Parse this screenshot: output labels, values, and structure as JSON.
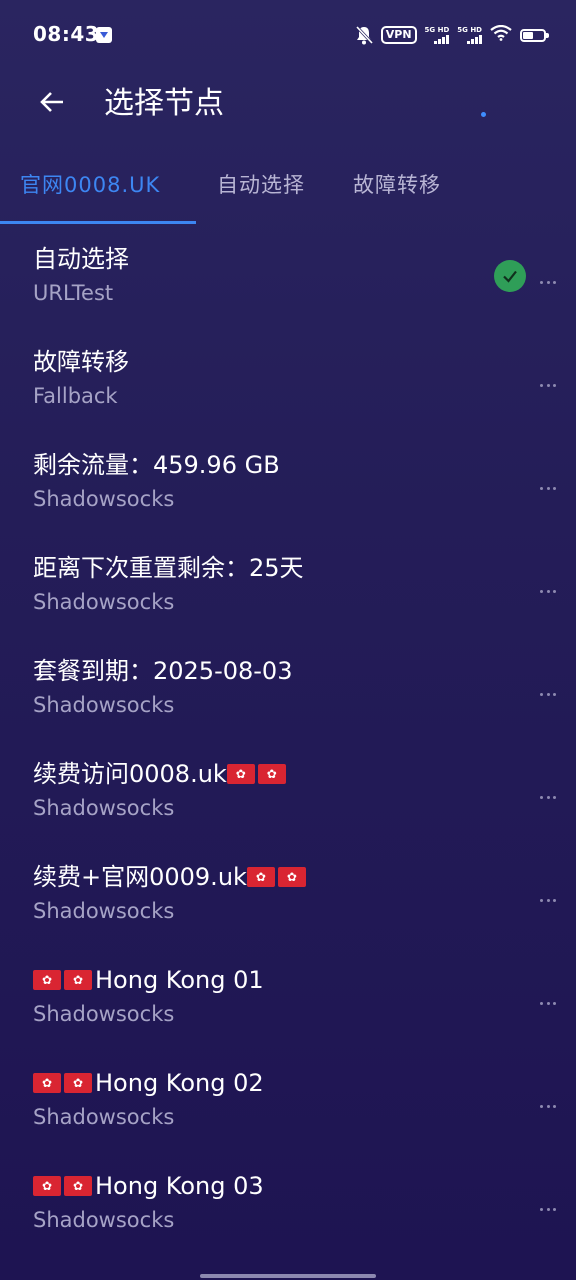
{
  "status_bar": {
    "time": "08:43",
    "vpn": "VPN",
    "sim1": "5G HD",
    "sim2": "5G HD"
  },
  "app_bar": {
    "title": "选择节点"
  },
  "tabs": [
    {
      "label": "官网0008.UK",
      "active": true
    },
    {
      "label": "自动选择",
      "active": false
    },
    {
      "label": "故障转移",
      "active": false
    }
  ],
  "proxies": [
    {
      "name": "自动选择",
      "type": "URLTest",
      "selected": true
    },
    {
      "name": "故障转移",
      "type": "Fallback"
    },
    {
      "name": "剩余流量：459.96 GB",
      "type": "Shadowsocks"
    },
    {
      "name": "距离下次重置剩余：25天",
      "type": "Shadowsocks"
    },
    {
      "name": "套餐到期：2025-08-03",
      "type": "Shadowsocks"
    },
    {
      "name": "续费访问0008.uk",
      "type": "Shadowsocks",
      "flags": "🇭🇰🇭🇰"
    },
    {
      "name": "续费+官网0009.uk",
      "type": "Shadowsocks",
      "flags": "🇭🇰🇭🇰"
    },
    {
      "name": "Hong Kong 01",
      "type": "Shadowsocks",
      "flags": "🇭🇰🇭🇰"
    },
    {
      "name": "Hong Kong 02",
      "type": "Shadowsocks",
      "flags": "🇭🇰🇭🇰"
    },
    {
      "name": "Hong Kong 03",
      "type": "Shadowsocks",
      "flags": "🇭🇰🇭🇰"
    }
  ],
  "colors": {
    "accent": "#3d86f2",
    "selected": "#2f9e58",
    "background": "#241d58"
  }
}
